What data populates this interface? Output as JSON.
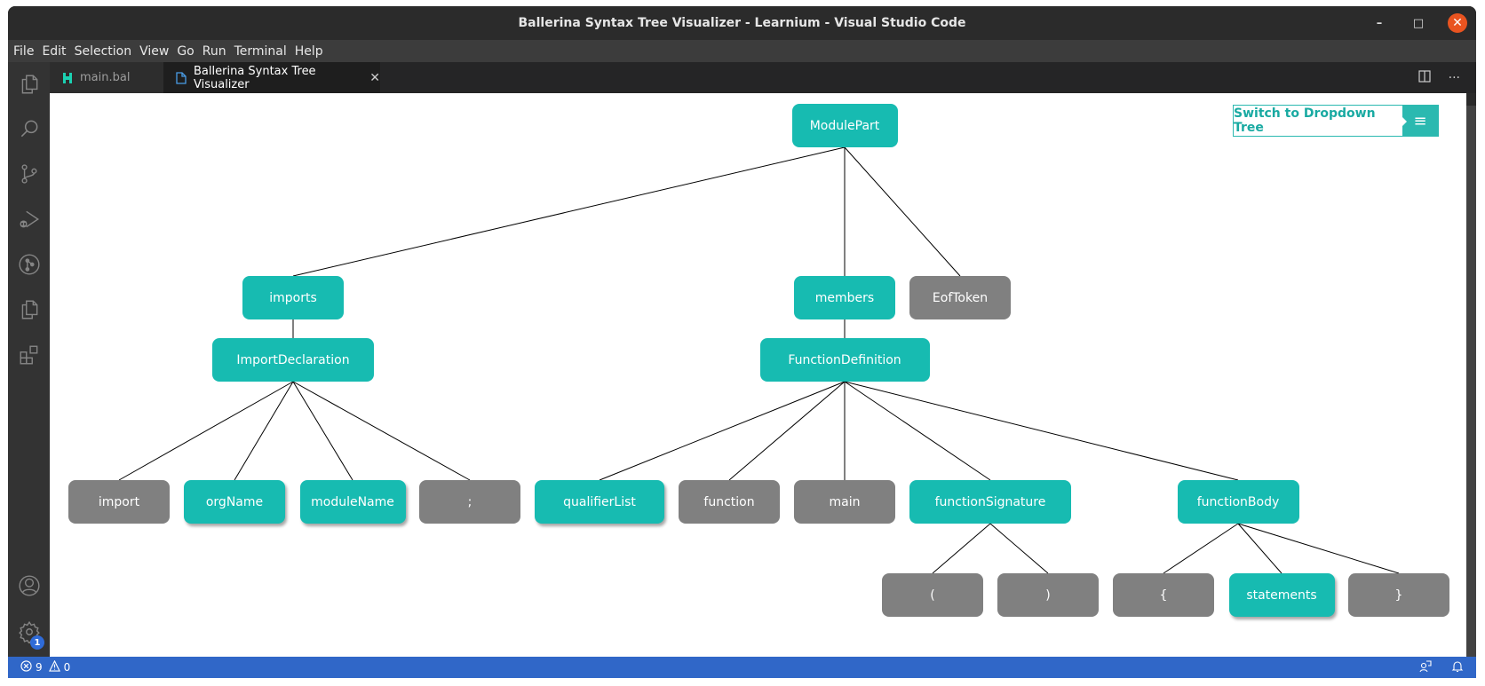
{
  "window": {
    "title": "Ballerina Syntax Tree Visualizer - Learnium - Visual Studio Code",
    "controls": {
      "minimize": "–",
      "maximize": "□",
      "close": "✕"
    }
  },
  "menu": [
    "File",
    "Edit",
    "Selection",
    "View",
    "Go",
    "Run",
    "Terminal",
    "Help"
  ],
  "activity_bar": {
    "top": [
      "explorer-icon",
      "search-icon",
      "source-control-icon",
      "run-debug-icon",
      "git-graph-icon",
      "pages-icon",
      "extensions-icon"
    ],
    "bottom": [
      "account-icon",
      "settings-gear-icon"
    ],
    "settings_badge": "1"
  },
  "tabs": [
    {
      "label": "main.bal",
      "icon": "ballerina-icon",
      "active": false
    },
    {
      "label": "Ballerina Syntax Tree Visualizer",
      "icon": "file-icon",
      "active": true,
      "close": "✕"
    }
  ],
  "tab_actions": {
    "split": "split-editor-icon",
    "more": "···"
  },
  "visualizer": {
    "switch_button": {
      "label": "Switch to Dropdown Tree",
      "icon": "≡"
    },
    "colors": {
      "node_teal": "#17bbb1",
      "node_grey": "#808080",
      "edge": "#000000"
    },
    "nodes": [
      {
        "id": "ModulePart",
        "label": "ModulePart",
        "kind": "teal",
        "parent": null
      },
      {
        "id": "imports",
        "label": "imports",
        "kind": "teal",
        "parent": "ModulePart"
      },
      {
        "id": "members",
        "label": "members",
        "kind": "teal",
        "parent": "ModulePart"
      },
      {
        "id": "EofToken",
        "label": "EofToken",
        "kind": "grey",
        "parent": "ModulePart"
      },
      {
        "id": "ImportDeclaration",
        "label": "ImportDeclaration",
        "kind": "teal",
        "parent": "imports"
      },
      {
        "id": "FunctionDefinition",
        "label": "FunctionDefinition",
        "kind": "teal",
        "parent": "members"
      },
      {
        "id": "import",
        "label": "import",
        "kind": "grey",
        "parent": "ImportDeclaration"
      },
      {
        "id": "orgName",
        "label": "orgName",
        "kind": "teal",
        "shadow": true,
        "parent": "ImportDeclaration"
      },
      {
        "id": "moduleName",
        "label": "moduleName",
        "kind": "teal",
        "shadow": true,
        "parent": "ImportDeclaration"
      },
      {
        "id": "semicolon",
        "label": ";",
        "kind": "grey",
        "parent": "ImportDeclaration"
      },
      {
        "id": "qualifierList",
        "label": "qualifierList",
        "kind": "teal",
        "shadow": true,
        "parent": "FunctionDefinition"
      },
      {
        "id": "function",
        "label": "function",
        "kind": "grey",
        "parent": "FunctionDefinition"
      },
      {
        "id": "main",
        "label": "main",
        "kind": "grey",
        "parent": "FunctionDefinition"
      },
      {
        "id": "functionSignature",
        "label": "functionSignature",
        "kind": "teal",
        "parent": "FunctionDefinition"
      },
      {
        "id": "functionBody",
        "label": "functionBody",
        "kind": "teal",
        "parent": "FunctionDefinition"
      },
      {
        "id": "openParen",
        "label": "(",
        "kind": "grey",
        "parent": "functionSignature"
      },
      {
        "id": "closeParen",
        "label": ")",
        "kind": "grey",
        "parent": "functionSignature"
      },
      {
        "id": "openBrace",
        "label": "{",
        "kind": "grey",
        "parent": "functionBody"
      },
      {
        "id": "statements",
        "label": "statements",
        "kind": "teal",
        "shadow": true,
        "parent": "functionBody"
      },
      {
        "id": "closeBrace",
        "label": "}",
        "kind": "grey",
        "parent": "functionBody"
      }
    ]
  },
  "status_bar": {
    "errors": "9",
    "warnings": "0",
    "right_icons": [
      "feedback-icon",
      "notifications-bell-icon"
    ]
  }
}
